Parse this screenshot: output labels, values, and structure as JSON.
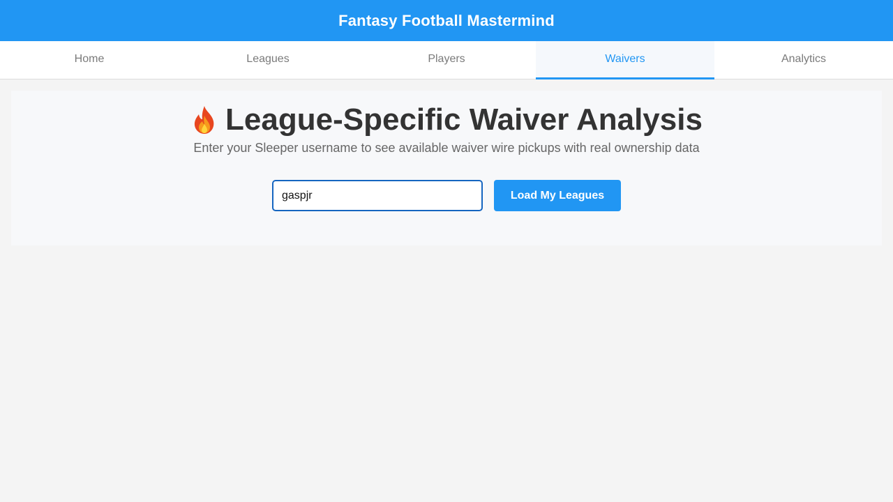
{
  "app": {
    "title": "Fantasy Football Mastermind"
  },
  "nav": {
    "tabs": [
      {
        "label": "Home"
      },
      {
        "label": "Leagues"
      },
      {
        "label": "Players"
      },
      {
        "label": "Waivers",
        "active": true
      },
      {
        "label": "Analytics"
      }
    ]
  },
  "main": {
    "title_icon": "flame-icon",
    "title": "League-Specific Waiver Analysis",
    "subtitle": "Enter your Sleeper username to see available waiver wire pickups with real ownership data",
    "username_value": "gaspjr",
    "load_button_label": "Load My Leagues"
  },
  "colors": {
    "brand": "#2196f3",
    "input_border": "#1565c0",
    "background": "#f4f4f4"
  }
}
